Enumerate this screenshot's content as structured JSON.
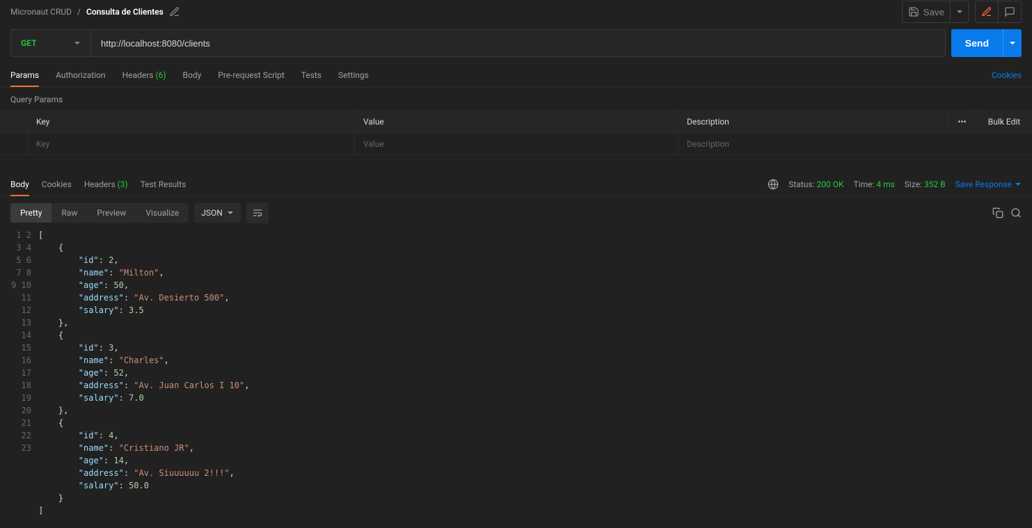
{
  "breadcrumb": {
    "collection": "Micronaut CRUD",
    "sep": "/",
    "request_name": "Consulta de Clientes"
  },
  "top": {
    "save_label": "Save"
  },
  "request": {
    "method": "GET",
    "url": "http://localhost:8080/clients",
    "send_label": "Send"
  },
  "req_tabs": {
    "params": "Params",
    "auth": "Authorization",
    "headers": "Headers",
    "headers_count": "(6)",
    "body": "Body",
    "prerequest": "Pre-request Script",
    "tests": "Tests",
    "settings": "Settings",
    "cookies": "Cookies"
  },
  "query_params": {
    "label": "Query Params",
    "headers": {
      "key": "Key",
      "value": "Value",
      "desc": "Description"
    },
    "placeholders": {
      "key": "Key",
      "value": "Value",
      "desc": "Description"
    },
    "more_icon": "•••",
    "bulk": "Bulk Edit"
  },
  "resp_tabs": {
    "body": "Body",
    "cookies": "Cookies",
    "headers": "Headers",
    "headers_count": "(3)",
    "tests": "Test Results"
  },
  "resp_meta": {
    "status_label": "Status:",
    "status_val": "200 OK",
    "time_label": "Time:",
    "time_val": "4 ms",
    "size_label": "Size:",
    "size_val": "352 B",
    "save_response": "Save Response"
  },
  "view": {
    "pretty": "Pretty",
    "raw": "Raw",
    "preview": "Preview",
    "visualize": "Visualize",
    "format": "JSON"
  },
  "response_body": [
    {
      "id": 2,
      "name": "Milton",
      "age": 50,
      "address": "Av. Desierto 500",
      "salary": 3.5
    },
    {
      "id": 3,
      "name": "Charles",
      "age": 52,
      "address": "Av. Juan Carlos I 10",
      "salary": 7.0
    },
    {
      "id": 4,
      "name": "Cristiano JR",
      "age": 14,
      "address": "Av. Siuuuuuu 2!!!",
      "salary": 50.0
    }
  ],
  "line_count": 23
}
